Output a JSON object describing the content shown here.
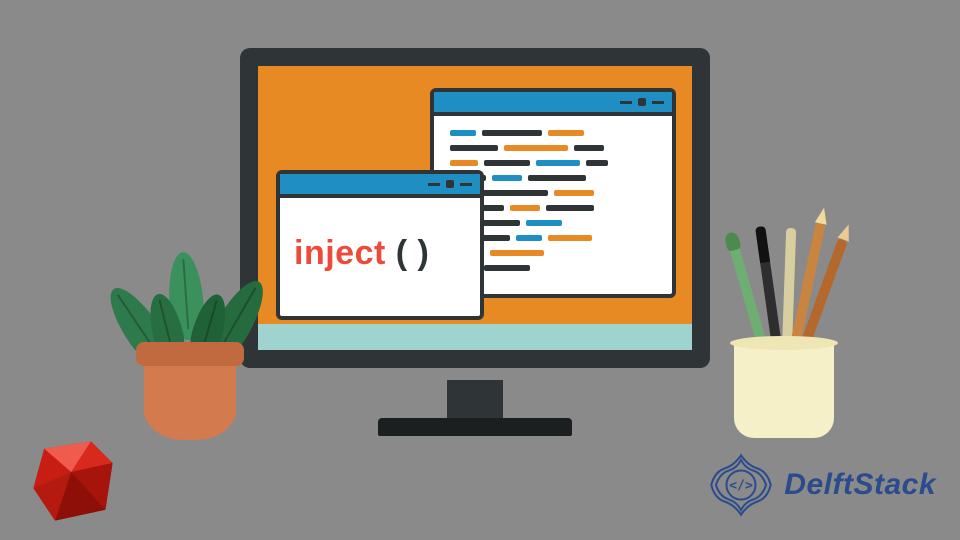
{
  "colors": {
    "background": "#8a8a8a",
    "monitor_bezel": "#2f3436",
    "screen_bg": "#e88a24",
    "window_titlebar": "#1f8fc3",
    "inject_method_color": "#ed4a3a",
    "delft_blue": "#2a4b8d"
  },
  "main_graphic": {
    "method_name": "inject",
    "parentheses": "( )"
  },
  "branding": {
    "site_name": "DelftStack",
    "language_icon": "ruby"
  },
  "decor": {
    "plant": "potted-plant",
    "pen_cup": "pen-holder"
  }
}
